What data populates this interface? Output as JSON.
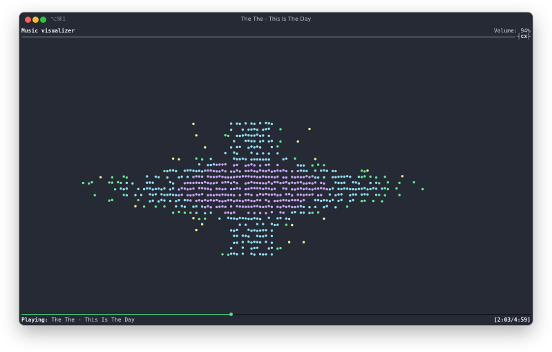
{
  "window": {
    "title": "The The - This Is The Day",
    "shortcut": "⌥⌘1"
  },
  "header": {
    "title": "Music visualizer",
    "volume": "Volume: 94%",
    "tag": "cx"
  },
  "visualizer": {
    "colors": {
      "yellow": "#f3ef8f",
      "green": "#61e890",
      "cyan": "#8edcf0",
      "purple": "#c7a4f4"
    }
  },
  "status": {
    "playing_label": "Playing:",
    "track": "The The - This Is The Day",
    "time": "[2:03/4:59]",
    "progress": 0.411
  }
}
